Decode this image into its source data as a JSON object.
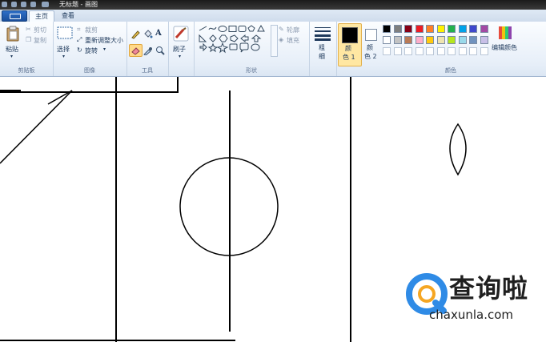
{
  "window": {
    "title": "无标题 - 画图"
  },
  "tabs": [
    {
      "label": "主页"
    },
    {
      "label": "查看"
    }
  ],
  "ribbon": {
    "clipboard": {
      "paste": "粘贴",
      "cut": "剪切",
      "copy": "复制",
      "group": "剪贴板"
    },
    "image": {
      "select": "选择",
      "crop": "裁剪",
      "resize": "重新调整大小",
      "rotate": "旋转",
      "group": "图像"
    },
    "tools": {
      "group": "工具"
    },
    "brushes": {
      "label": "刷子"
    },
    "shapes": {
      "outline": "轮廓",
      "fill": "填充",
      "group": "形状"
    },
    "size": {
      "label_line1": "粗",
      "label_line2": "细"
    },
    "color1": {
      "label_line1": "颜",
      "label_line2": "色 1",
      "value": "#000000"
    },
    "color2": {
      "label_line1": "颜",
      "label_line2": "色 2",
      "value": "#ffffff"
    },
    "colors": {
      "group": "颜色",
      "edit": "编辑颜色",
      "palette_row1": [
        "#000000",
        "#7f7f7f",
        "#880015",
        "#ed1c24",
        "#ff7f27",
        "#fff200",
        "#22b14c",
        "#00a2e8",
        "#3f48cc",
        "#a349a4"
      ],
      "palette_row2": [
        "#ffffff",
        "#c3c3c3",
        "#b97a57",
        "#ffaec9",
        "#ffc90e",
        "#efe4b0",
        "#b5e61d",
        "#99d9ea",
        "#7092be",
        "#c8bfe7"
      ]
    }
  },
  "watermark": {
    "text": "查询啦",
    "domain": "chaxunla.com",
    "accent": "#2f8be6",
    "accent2": "#f5a623"
  }
}
